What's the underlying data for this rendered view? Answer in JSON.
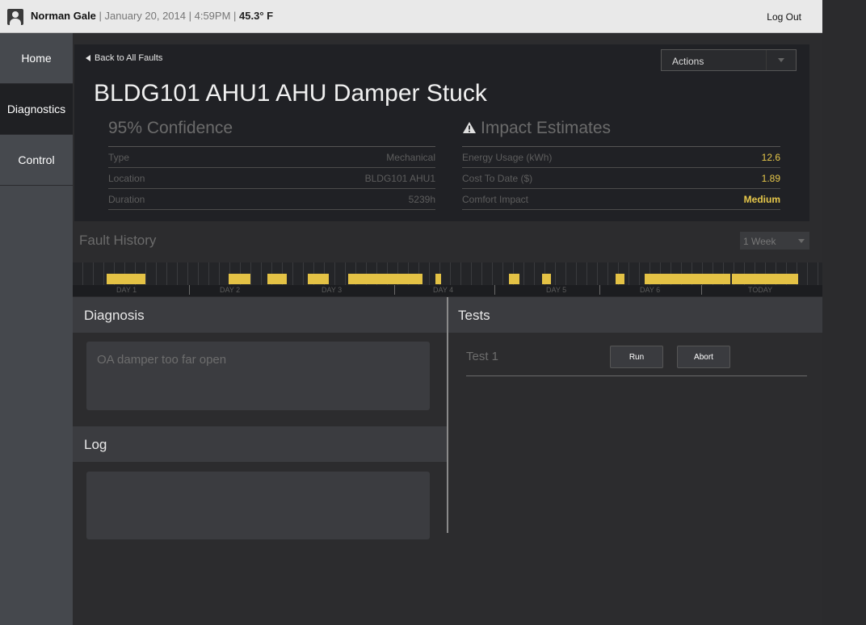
{
  "header": {
    "user_name": "Norman Gale",
    "sep1": " | ",
    "date": "January 20, 2014",
    "sep2": " | ",
    "time": "4:59PM",
    "sep3": " | ",
    "temperature": "45.3° F",
    "logout": "Log Out"
  },
  "sidebar": {
    "items": [
      {
        "label": "Home"
      },
      {
        "label": "Diagnostics"
      },
      {
        "label": "Control"
      }
    ]
  },
  "fault": {
    "back": "Back to All Faults",
    "actions": "Actions",
    "title": "BLDG101 AHU1 AHU Damper Stuck",
    "confidence": "95% Confidence",
    "details": [
      {
        "label": "Type",
        "value": "Mechanical"
      },
      {
        "label": "Location",
        "value": "BLDG101 AHU1"
      },
      {
        "label": "Duration",
        "value": "5239h"
      }
    ],
    "impact_title": "Impact Estimates",
    "impacts": [
      {
        "label": "Energy Usage (kWh)",
        "value": "12.6"
      },
      {
        "label": "Cost To Date ($)",
        "value": "1.89"
      },
      {
        "label": "Comfort Impact",
        "value": "Medium"
      }
    ]
  },
  "history": {
    "title": "Fault History",
    "range": "1 Week",
    "days": [
      "DAY 1",
      "DAY 2",
      "DAY 3",
      "DAY 4",
      "DAY 5",
      "DAY 6",
      "TODAY"
    ]
  },
  "diagnosis": {
    "title": "Diagnosis",
    "text": "OA damper too far open"
  },
  "log": {
    "title": "Log",
    "text": ""
  },
  "tests": {
    "title": "Tests",
    "items": [
      {
        "name": "Test 1",
        "run": "Run",
        "abort": "Abort"
      }
    ]
  },
  "colors": {
    "accent_yellow": "#e4c245",
    "panel_dark": "#202125",
    "section_header": "#3b3c40"
  }
}
